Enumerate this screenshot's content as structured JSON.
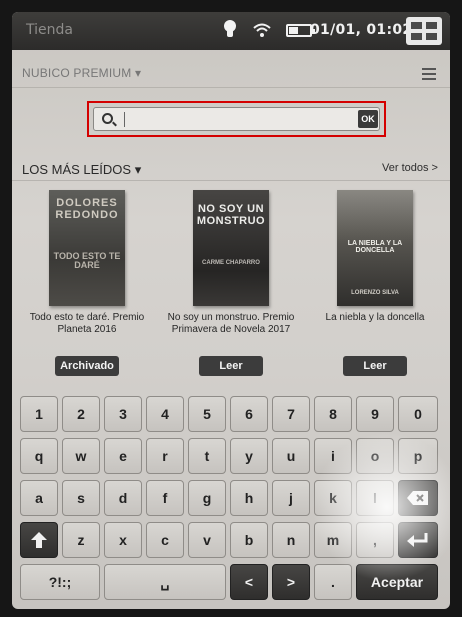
{
  "status_bar": {
    "store_label": "Tienda",
    "time": "01/01, 01:02"
  },
  "catalog": {
    "title": "NUBICO PREMIUM ▾"
  },
  "search": {
    "value": "",
    "ok_label": "OK"
  },
  "section": {
    "title": "LOS MÁS LEÍDOS ▾",
    "see_all": "Ver todos >"
  },
  "books": [
    {
      "cover_text": "DOLORES REDONDO",
      "cover_subtext": "TODO ESTO TE DARÉ",
      "title": "Todo esto te daré. Premio Planeta 2016",
      "action": "Archivado"
    },
    {
      "cover_text": "NO SOY UN MONSTRUO",
      "cover_subtext": "CARME CHAPARRO",
      "title": "No soy un monstruo. Premio Primavera de Novela 2017",
      "action": "Leer"
    },
    {
      "cover_text": "LA NIEBLA Y LA DONCELLA",
      "cover_subtext": "LORENZO SILVA",
      "title": "La niebla y la doncella",
      "action": "Leer"
    }
  ],
  "keyboard": {
    "row1": [
      "1",
      "2",
      "3",
      "4",
      "5",
      "6",
      "7",
      "8",
      "9",
      "0"
    ],
    "row2": [
      "q",
      "w",
      "e",
      "r",
      "t",
      "y",
      "u",
      "i",
      "o",
      "p"
    ],
    "row3": [
      "a",
      "s",
      "d",
      "f",
      "g",
      "h",
      "j",
      "k",
      "l"
    ],
    "row4": [
      "z",
      "x",
      "c",
      "v",
      "b",
      "n",
      "m",
      ","
    ],
    "symbols_label": "?!:;",
    "space_label": "␣",
    "period_label": ".",
    "accept_label": "Aceptar",
    "left_arrow": "<",
    "right_arrow": ">",
    "backspace_icon": "backspace-icon",
    "shift_icon": "shift-icon",
    "enter_icon": "enter-icon"
  }
}
